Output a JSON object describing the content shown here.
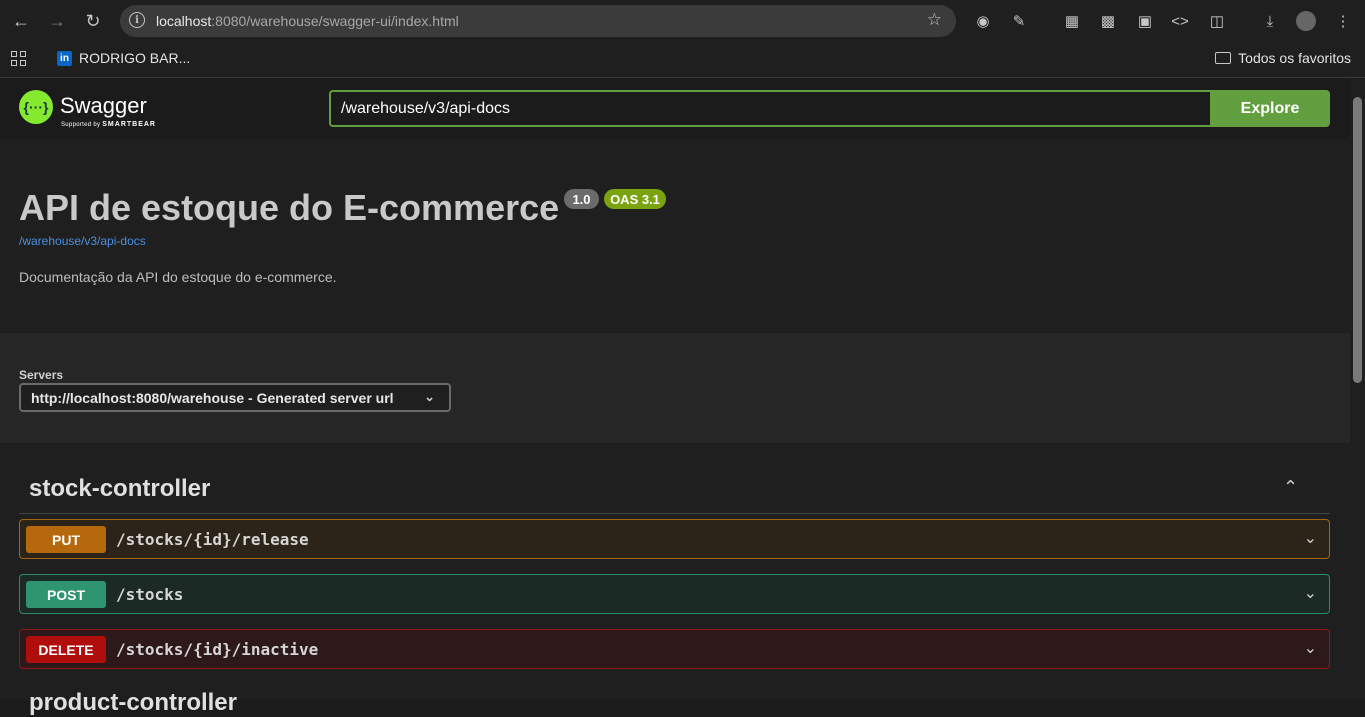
{
  "browser": {
    "url_host": "localhost",
    "url_rest": ":8080/warehouse/swagger-ui/index.html",
    "bookmark_label": "RODRIGO BAR...",
    "bookmark_icon_text": "in",
    "favorites_label": "Todos os favoritos"
  },
  "swagger": {
    "logo_name": "Swagger",
    "logo_sub": "Supported by",
    "logo_brand": "SMARTBEAR",
    "spec_url": "/warehouse/v3/api-docs",
    "explore_label": "Explore"
  },
  "info": {
    "title": "API de estoque do E-commerce",
    "version": "1.0",
    "oas": "OAS 3.1",
    "link": "/warehouse/v3/api-docs",
    "description": "Documentação da API do estoque do e-commerce."
  },
  "servers": {
    "label": "Servers",
    "selected": "http://localhost:8080/warehouse - Generated server url"
  },
  "tag": {
    "name": "stock-controller",
    "operations": [
      {
        "method": "PUT",
        "path": "/stocks/{id}/release"
      },
      {
        "method": "POST",
        "path": "/stocks"
      },
      {
        "method": "DELETE",
        "path": "/stocks/{id}/inactive"
      }
    ]
  },
  "next_tag": "product-controller",
  "colors": {
    "put": "#b5690c",
    "post": "#2f9570",
    "delete": "#b00d0d",
    "explore": "#62a03f",
    "oas_badge": "#7aa30f"
  }
}
